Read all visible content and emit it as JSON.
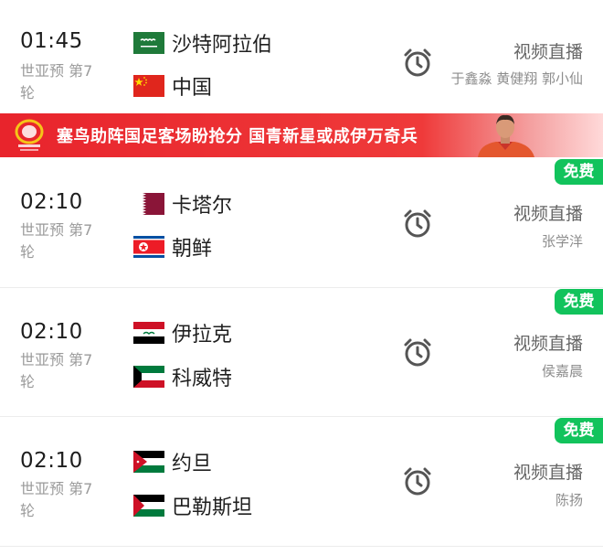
{
  "matches": [
    {
      "time": "01:45",
      "round": "世亚预 第7轮",
      "home": "沙特阿拉伯",
      "away": "中国",
      "live": "视频直播",
      "commentators": "于鑫淼 黄健翔 郭小仙",
      "free": ""
    },
    {
      "time": "02:10",
      "round": "世亚预 第7轮",
      "home": "卡塔尔",
      "away": "朝鲜",
      "live": "视频直播",
      "commentators": "张学洋",
      "free": "免费"
    },
    {
      "time": "02:10",
      "round": "世亚预 第7轮",
      "home": "伊拉克",
      "away": "科威特",
      "live": "视频直播",
      "commentators": "侯嘉晨",
      "free": "免费"
    },
    {
      "time": "02:10",
      "round": "世亚预 第7轮",
      "home": "约旦",
      "away": "巴勒斯坦",
      "live": "视频直播",
      "commentators": "陈扬",
      "free": "免费"
    }
  ],
  "banner": {
    "text": "塞鸟助阵国足客场盼抢分 国青新星或成伊万奇兵"
  },
  "colors": {
    "free_badge": "#12c35c",
    "banner": "#e8242c",
    "alarm": "#555555"
  },
  "icons": {
    "alarm": "alarm-clock-icon"
  }
}
